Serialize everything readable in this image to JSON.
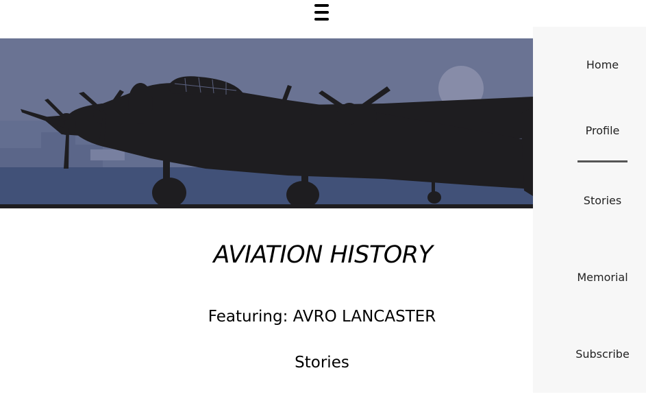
{
  "menu": {
    "icon": "hamburger-menu-icon"
  },
  "hero": {
    "image": "avro-lancaster-silhouette-at-dusk"
  },
  "content": {
    "title": "AVIATION HISTORY",
    "featuring": "Featuring: AVRO LANCASTER",
    "section_heading": "Stories"
  },
  "nav": {
    "items": [
      {
        "label": "Home"
      },
      {
        "label": "Profile"
      },
      {
        "label": "Stories"
      },
      {
        "label": "Memorial"
      },
      {
        "label": "Subscribe"
      }
    ],
    "active_index": 1
  },
  "colors": {
    "sky": "#6a7393",
    "ground": "#415178",
    "moon": "#878ca8",
    "silhouette": "#1e1d20",
    "sidebar": "#f7f7f7"
  }
}
